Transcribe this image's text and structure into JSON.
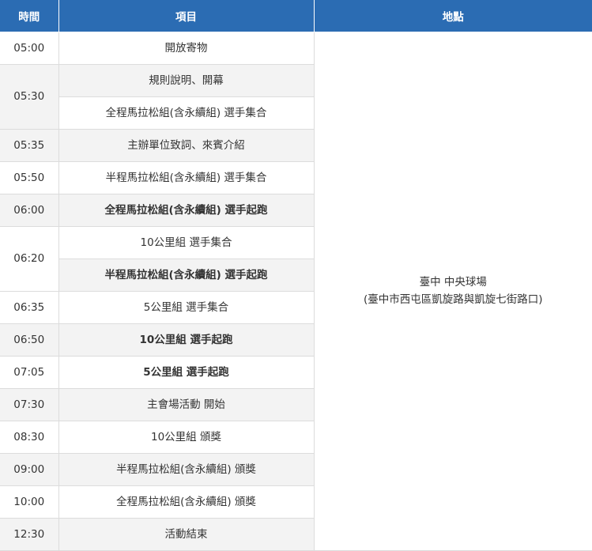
{
  "table": {
    "headers": {
      "time": "時間",
      "item": "項目",
      "location": "地點"
    },
    "location_line1": "臺中 中央球場",
    "location_line2": "(臺中市西屯區凱旋路與凱旋七街路口)",
    "rows": [
      {
        "time": "05:00",
        "item": "開放寄物",
        "bold": false
      },
      {
        "time": "05:30",
        "item": "規則說明、開幕",
        "bold": false
      },
      {
        "time": "",
        "item": "全程馬拉松組(含永續組) 選手集合",
        "bold": false
      },
      {
        "time": "05:35",
        "item": "主辦單位致詞、來賓介紹",
        "bold": false
      },
      {
        "time": "05:50",
        "item": "半程馬拉松組(含永續組) 選手集合",
        "bold": false
      },
      {
        "time": "06:00",
        "item": "全程馬拉松組(含永續組) 選手起跑",
        "bold": true
      },
      {
        "time": "06:20",
        "item": "10公里組 選手集合",
        "bold": false
      },
      {
        "time": "",
        "item": "半程馬拉松組(含永續組) 選手起跑",
        "bold": true
      },
      {
        "time": "06:35",
        "item": "5公里組 選手集合",
        "bold": false
      },
      {
        "time": "06:50",
        "item": "10公里組 選手起跑",
        "bold": true
      },
      {
        "time": "07:05",
        "item": "5公里組 選手起跑",
        "bold": true
      },
      {
        "time": "07:30",
        "item": "主會場活動 開始",
        "bold": false
      },
      {
        "time": "08:30",
        "item": "10公里組 頒獎",
        "bold": false
      },
      {
        "time": "09:00",
        "item": "半程馬拉松組(含永續組) 頒獎",
        "bold": false
      },
      {
        "time": "10:00",
        "item": "全程馬拉松組(含永續組) 頒獎",
        "bold": false
      },
      {
        "time": "12:30",
        "item": "活動結束",
        "bold": false
      }
    ]
  }
}
